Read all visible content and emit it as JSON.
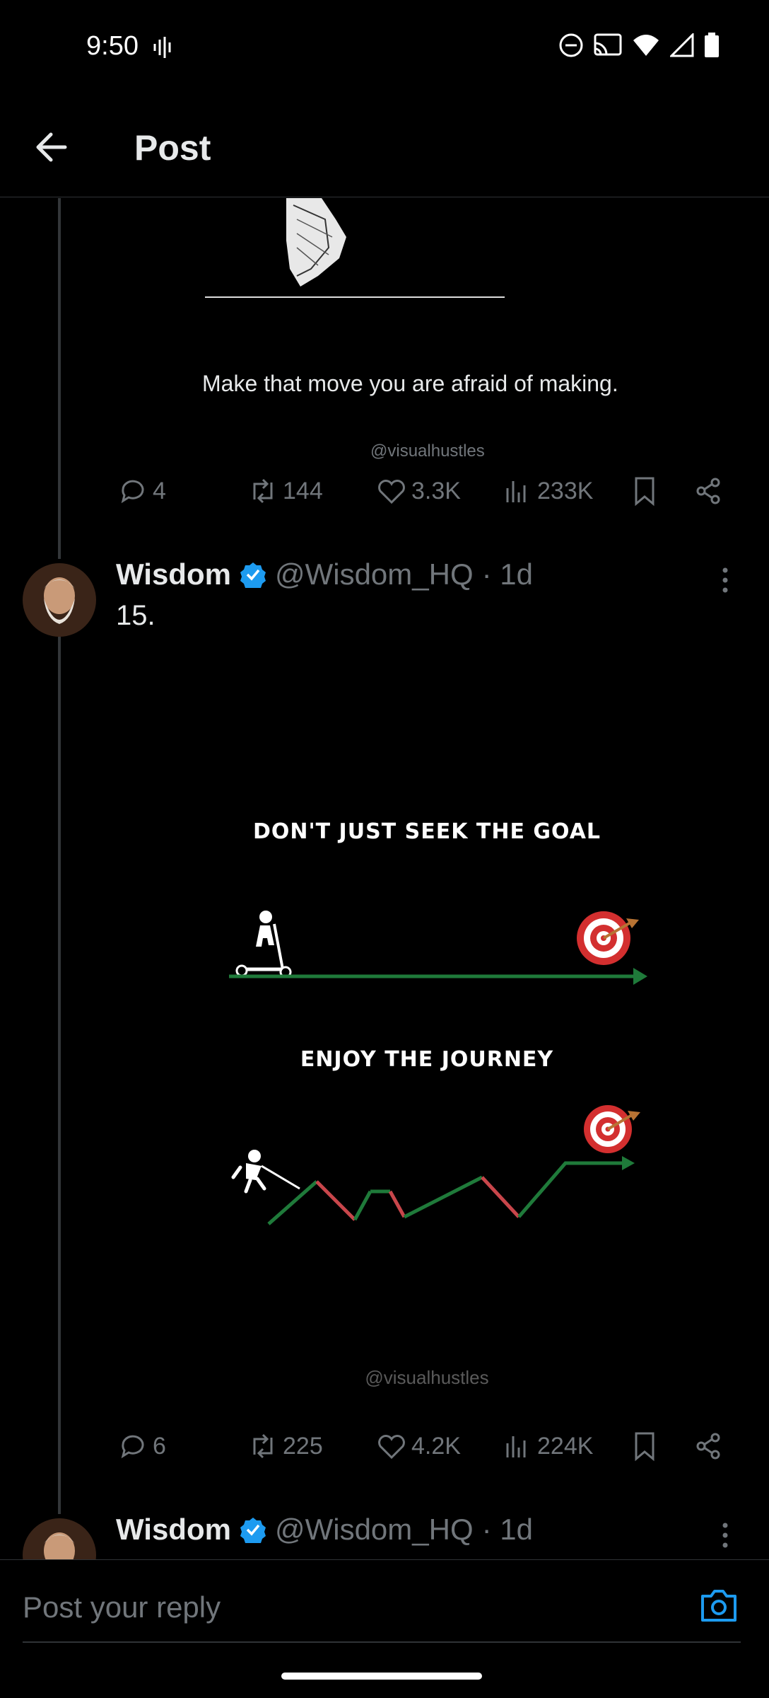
{
  "status_bar": {
    "time": "9:50"
  },
  "header": {
    "title": "Post"
  },
  "post1": {
    "caption": "Make that move you are afraid of making.",
    "watermark": "@visualhustles",
    "replies": "4",
    "reposts": "144",
    "likes": "3.3K",
    "views": "233K"
  },
  "post2": {
    "author": "Wisdom",
    "handle": "@Wisdom_HQ",
    "time": "· 1d",
    "text": "15.",
    "image_text_top": "DON'T JUST SEEK THE GOAL",
    "image_text_bottom": "ENJOY THE JOURNEY",
    "watermark": "@visualhustles",
    "replies": "6",
    "reposts": "225",
    "likes": "4.2K",
    "views": "224K"
  },
  "post3": {
    "author": "Wisdom",
    "handle": "@Wisdom_HQ",
    "time": "· 1d"
  },
  "reply": {
    "placeholder": "Post your reply"
  },
  "colors": {
    "accent": "#1d9bf0",
    "green": "#1f7a3a",
    "red": "#c8464b",
    "target_red": "#d32f2f"
  }
}
